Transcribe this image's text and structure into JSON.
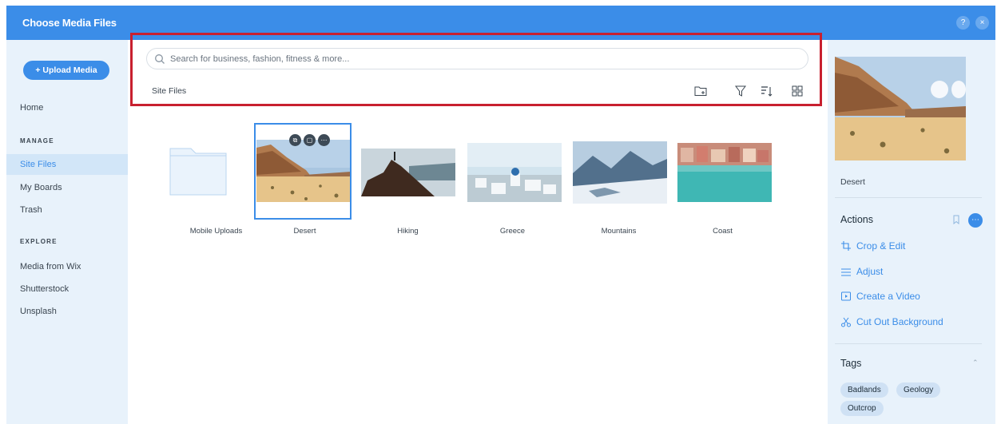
{
  "header": {
    "title": "Choose Media Files",
    "help_icon": "?",
    "close_icon": "×"
  },
  "sidebar": {
    "upload_label": "+ Upload Media",
    "home_label": "Home",
    "manage_heading": "MANAGE",
    "manage_items": [
      {
        "label": "Site Files"
      },
      {
        "label": "My Boards"
      },
      {
        "label": "Trash"
      }
    ],
    "explore_heading": "EXPLORE",
    "explore_items": [
      {
        "label": "Media from Wix"
      },
      {
        "label": "Shutterstock"
      },
      {
        "label": "Unsplash"
      }
    ]
  },
  "main": {
    "search_placeholder": "Search for business, fashion, fitness & more...",
    "location_label": "Site Files",
    "toolbar_icons": [
      "new-folder-icon",
      "filter-icon",
      "sort-icon",
      "grid-view-icon"
    ],
    "items": [
      {
        "label": "Mobile Uploads",
        "kind": "folder"
      },
      {
        "label": "Desert",
        "kind": "image",
        "selected": true
      },
      {
        "label": "Hiking",
        "kind": "image"
      },
      {
        "label": "Greece",
        "kind": "image"
      },
      {
        "label": "Mountains",
        "kind": "image"
      },
      {
        "label": "Coast",
        "kind": "image"
      }
    ]
  },
  "details": {
    "file_name": "Desert",
    "actions_heading": "Actions",
    "actions": [
      {
        "label": "Crop & Edit",
        "icon": "crop-icon"
      },
      {
        "label": "Adjust",
        "icon": "sliders-icon"
      },
      {
        "label": "Create a Video",
        "icon": "video-icon"
      },
      {
        "label": "Cut Out Background",
        "icon": "scissors-icon"
      }
    ],
    "tags_heading": "Tags",
    "tags": [
      "Badlands",
      "Geology",
      "Outcrop"
    ]
  },
  "colors": {
    "accent": "#3b8de8",
    "sidebar_bg": "#e8f2fb",
    "highlight": "#c8202f"
  }
}
